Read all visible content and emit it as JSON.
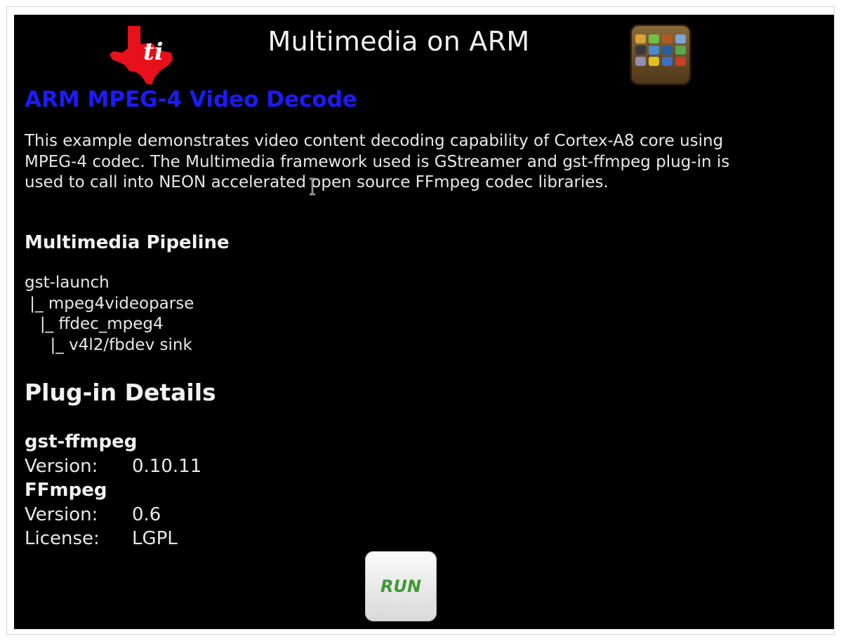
{
  "header": {
    "title": "Multimedia on ARM",
    "logo_icon": "ti-logo-icon",
    "apps_icon": "apps-grid-icon"
  },
  "main": {
    "heading": "ARM MPEG-4 Video Decode",
    "heading_color": "#1b1bff",
    "description": "This example demonstrates video content decoding capability of Cortex-A8 core using MPEG-4 codec. The Multimedia framework used is GStreamer and gst-ffmpeg plug-in is used to call into NEON accelerated open source FFmpeg codec libraries.",
    "pipeline_title": "Multimedia Pipeline",
    "pipeline": [
      "gst-launch",
      " |_ mpeg4videoparse",
      "   |_ ffdec_mpeg4",
      "     |_ v4l2/fbdev sink"
    ],
    "plugin_title": "Plug-in Details",
    "plugins": [
      {
        "name": "gst-ffmpeg",
        "fields": [
          {
            "key": "Version:",
            "value": "0.10.11"
          }
        ]
      },
      {
        "name": "FFmpeg",
        "fields": [
          {
            "key": "Version:",
            "value": "0.6"
          },
          {
            "key": "License:",
            "value": "LGPL"
          }
        ]
      }
    ]
  },
  "run_button": {
    "label": "RUN",
    "label_color": "#3f9a36"
  }
}
